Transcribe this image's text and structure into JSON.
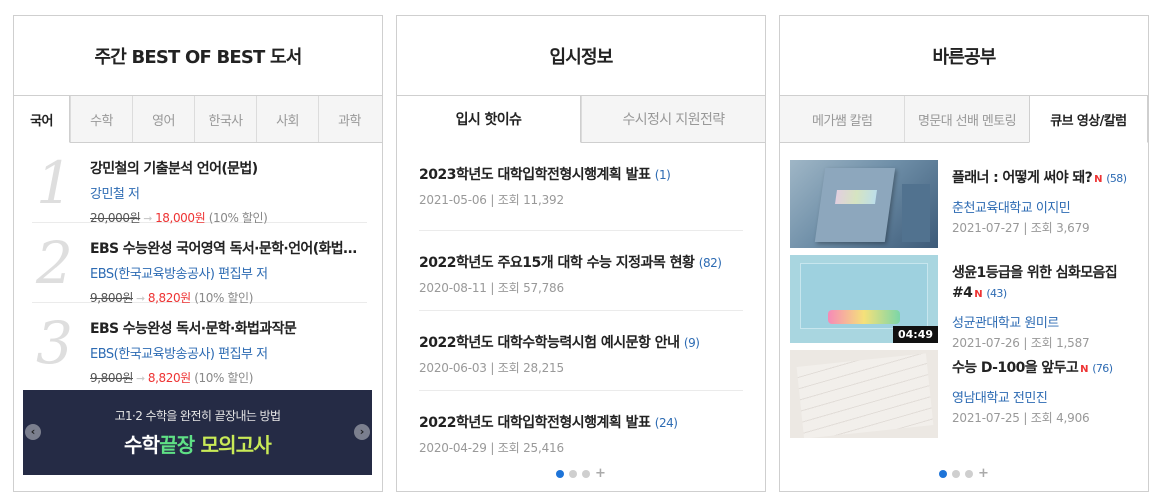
{
  "best": {
    "title": "주간 BEST OF BEST 도서",
    "tabs": [
      "국어",
      "수학",
      "영어",
      "한국사",
      "사회",
      "과학"
    ],
    "books": [
      {
        "rank": "1",
        "title": "강민철의 기출분석 언어(문법)",
        "author": "강민철 저",
        "orig": "20,000원",
        "sale": "18,000원",
        "discount": "(10% 할인)"
      },
      {
        "rank": "2",
        "title": "EBS 수능완성 국어영역 독서·문학·언어(화법과작문)",
        "author": "EBS(한국교육방송공사) 편집부 저",
        "orig": "9,800원",
        "sale": "8,820원",
        "discount": "(10% 할인)"
      },
      {
        "rank": "3",
        "title": "EBS 수능완성 독서·문학·화법과작문",
        "author": "EBS(한국교육방송공사) 편집부 저",
        "orig": "9,800원",
        "sale": "8,820원",
        "discount": "(10% 할인)"
      }
    ],
    "banner": {
      "top": "고1·2 수학을 완전히 끝장내는 방법",
      "main1": "수학",
      "main2": "끝장",
      "main3": " 모의고사"
    }
  },
  "admission": {
    "title": "입시정보",
    "tabs": [
      "입시 핫이슈",
      "수시정시 지원전략"
    ],
    "items": [
      {
        "title": "2023학년도 대학입학전형시행계획 발표",
        "count": "(1)",
        "meta": "2021-05-06 | 조회 11,392"
      },
      {
        "title": "2022학년도 주요15개 대학 수능 지정과목 현황",
        "count": "(82)",
        "meta": "2020-08-11 | 조회 57,786"
      },
      {
        "title": "2022학년도 대학수학능력시험 예시문항 안내",
        "count": "(9)",
        "meta": "2020-06-03 | 조회 28,215"
      },
      {
        "title": "2022학년도 대학입학전형시행계획 발표",
        "count": "(24)",
        "meta": "2020-04-29 | 조회 25,416"
      }
    ]
  },
  "study": {
    "title": "바른공부",
    "tabs": [
      "메가쌤 칼럼",
      "명문대 선배 멘토링",
      "큐브 영상/칼럼"
    ],
    "videos": [
      {
        "title": "플래너 : 어떻게 써야 돼?",
        "new": "N",
        "count": "(58)",
        "school": "춘천교육대학교 이지민",
        "meta": "2021-07-27 | 조회 3,679",
        "duration": ""
      },
      {
        "title": "생윤1등급을 위한 심화모음집 #4",
        "new": "N",
        "count": "(43)",
        "school": "성균관대학교 원미르",
        "meta": "2021-07-26 | 조회 1,587",
        "duration": "04:49"
      },
      {
        "title": "수능 D-100을 앞두고",
        "new": "N",
        "count": "(76)",
        "school": "영남대학교 전민진",
        "meta": "2021-07-25 | 조회 4,906",
        "duration": ""
      }
    ]
  },
  "colors": {
    "accent": "#1e74d8",
    "link": "#2d6bb3",
    "sale": "#e33333",
    "banner_bg": "#252b45"
  }
}
